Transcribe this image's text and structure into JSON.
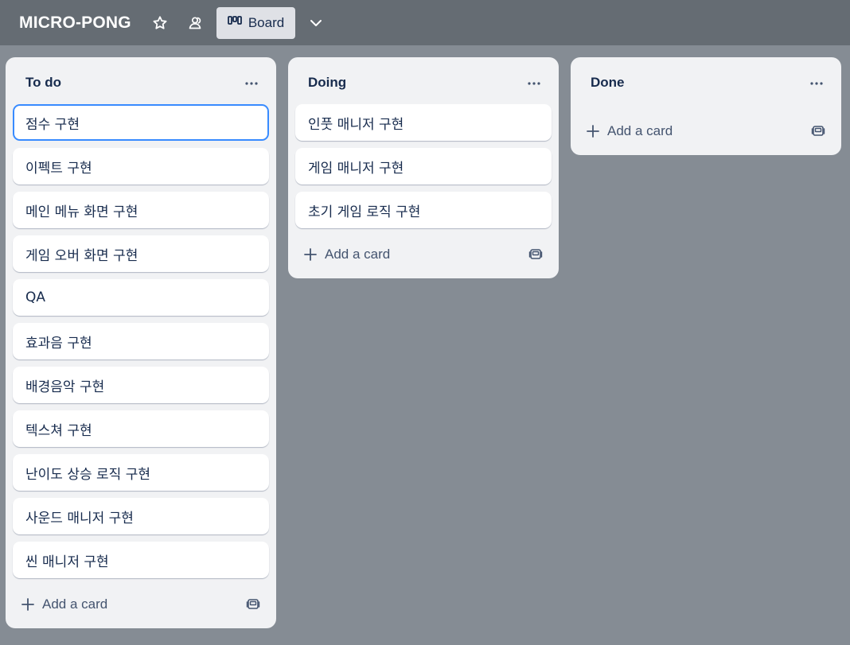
{
  "board": {
    "title": "MICRO-PONG",
    "view_label": "Board"
  },
  "lists": [
    {
      "title": "To do",
      "add_card": "Add a card",
      "cards": [
        "점수 구현",
        "이펙트 구현",
        "메인 메뉴 화면 구현",
        "게임 오버 화면 구현",
        "QA",
        "효과음 구현",
        "배경음악 구현",
        "텍스쳐 구현",
        "난이도 상승 로직 구현",
        "사운드 매니저 구현",
        "씬 매니저 구현"
      ]
    },
    {
      "title": "Doing",
      "add_card": "Add a card",
      "cards": [
        "인풋 매니저 구현",
        "게임 매니저 구현",
        "초기 게임 로직 구현"
      ]
    },
    {
      "title": "Done",
      "add_card": "Add a card",
      "cards": []
    }
  ],
  "icons": {
    "star": "star-icon",
    "visibility": "team-visibility-icon",
    "board_view": "board-view-icon",
    "chevron": "chevron-down-icon",
    "more": "more-horizontal-icon",
    "add": "plus-icon",
    "template": "card-template-icon"
  },
  "colors": {
    "header_bg": "#656c73",
    "board_bg": "#858c94",
    "list_bg": "#f1f2f4",
    "card_bg": "#ffffff",
    "focus_ring": "#388bff",
    "text": "#172b4d"
  }
}
